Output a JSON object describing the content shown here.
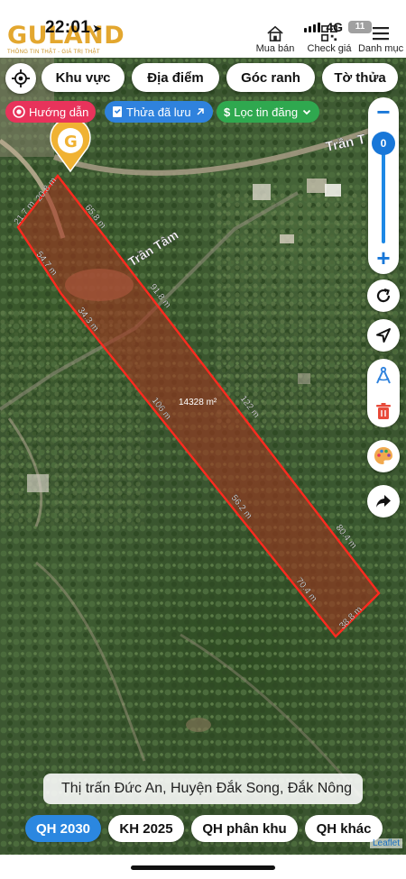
{
  "status": {
    "time": "22:01",
    "network": "4G",
    "battery": "11"
  },
  "logo": {
    "word": "GULAND",
    "tagline": "THÔNG TIN THẬT - GIÁ TRỊ THẬT"
  },
  "nav": [
    {
      "label": "Mua bán",
      "icon": "home-icon"
    },
    {
      "label": "Check giá",
      "icon": "qr-icon"
    },
    {
      "label": "Danh mục",
      "icon": "menu-icon"
    }
  ],
  "tabs": [
    "Khu vực",
    "Địa điểm",
    "Góc ranh",
    "Tờ thửa"
  ],
  "chips": {
    "directions": "Hướng dẫn",
    "saved": "Thửa đã lưu",
    "filter": "Lọc tin đăng"
  },
  "zoom": {
    "level": "0",
    "plus": "+",
    "minus": "−"
  },
  "map": {
    "area_label": "14328 m²",
    "road_name_1": "Trần Tâm",
    "road_name_2": "Trần T",
    "edges": [
      "20.8 m",
      "21.7 m",
      "65.8 m",
      "54.7 m",
      "34.3 m",
      "91.8 m",
      "106 m",
      "122 m",
      "56.2 m",
      "80.4 m",
      "70.4 m",
      "38.8 m"
    ]
  },
  "address": "Thị trấn Đức An, Huyện Đắk Song, Đắk Nông",
  "bottom_tabs": [
    "QH 2030",
    "KH 2025",
    "QH phân khu",
    "QH khác"
  ],
  "attribution": "Leaflet",
  "colors": {
    "accent": "#2b87e0",
    "parcel": "#ff2a1f",
    "logo": "#e3a72f",
    "chip_directions": "#e8335b",
    "chip_saved": "#2f82dd",
    "chip_filter": "#2fa84f"
  }
}
